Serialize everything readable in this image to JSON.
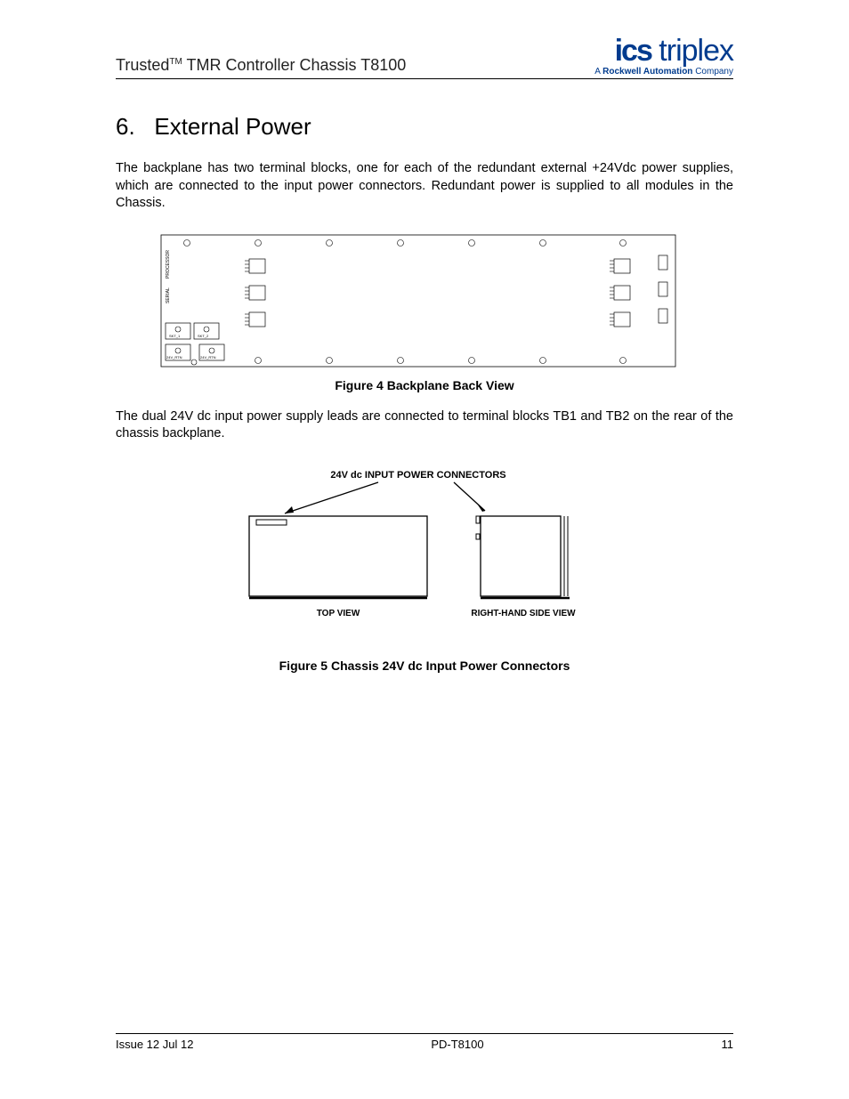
{
  "header": {
    "doc_title_prefix": "Trusted",
    "doc_title_tm": "TM",
    "doc_title_rest": " TMR Controller Chassis T8100",
    "logo_main_bold": "ics",
    "logo_main_light": " triplex",
    "logo_sub_prefix": "A ",
    "logo_sub_bold": "Rockwell Automation",
    "logo_sub_suffix": " Company"
  },
  "section": {
    "number": "6.",
    "title": "External Power"
  },
  "para1": "The backplane has two terminal blocks, one for each of the redundant external +24Vdc power supplies, which are connected to the input power connectors.  Redundant power is supplied to all modules in the Chassis.",
  "figure4": {
    "caption": "Figure 4 Backplane Back View",
    "labels": {
      "left_small": "PROCESSOR",
      "left_small2": "SERIAL",
      "box1": "SKT_1",
      "box2": "SKT_2",
      "box3": "24V_RTN",
      "box4": "24V_RTN"
    }
  },
  "para2": "The dual 24V dc input power supply leads are connected to terminal blocks TB1 and TB2 on the rear of the chassis backplane.",
  "figure5": {
    "caption": "Figure 5 Chassis 24V dc Input Power Connectors",
    "title": "24V dc INPUT POWER CONNECTORS",
    "top_view": "TOP VIEW",
    "side_view": "RIGHT-HAND SIDE VIEW"
  },
  "footer": {
    "left": "Issue 12 Jul 12",
    "center": "PD-T8100",
    "right": "11"
  }
}
